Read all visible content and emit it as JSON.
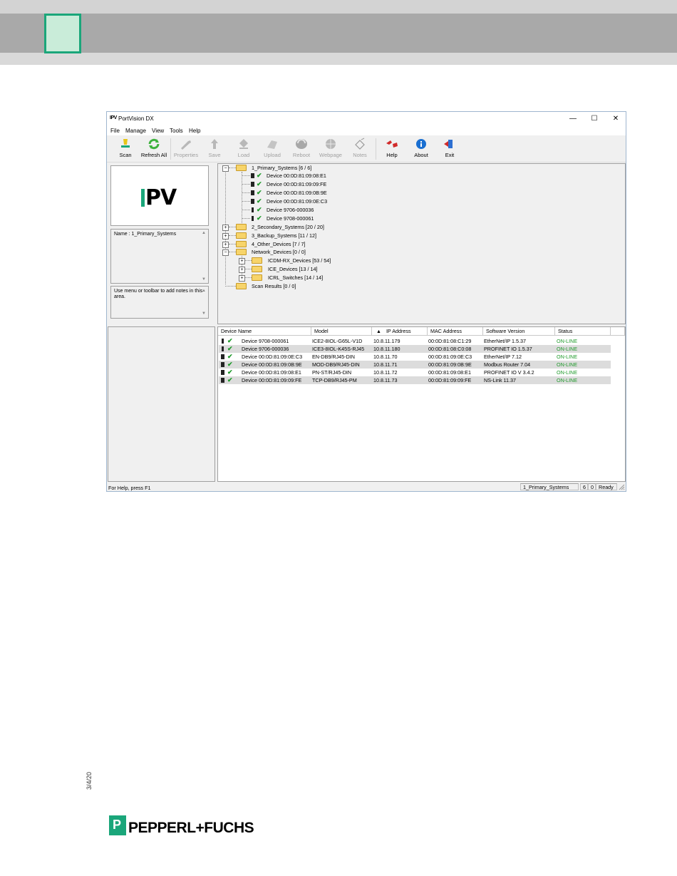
{
  "window": {
    "app_icon": "IPV",
    "title": "PortVision DX",
    "controls": [
      "—",
      "☐",
      "✕"
    ]
  },
  "menu": [
    "File",
    "Manage",
    "View",
    "Tools",
    "Help"
  ],
  "toolbar": {
    "scan": "Scan",
    "refresh_all": "Refresh All",
    "properties": "Properties",
    "save": "Save",
    "load": "Load",
    "upload": "Upload",
    "reboot": "Reboot",
    "webpage": "Webpage",
    "notes": "Notes",
    "help": "Help",
    "about": "About",
    "exit": "Exit"
  },
  "logo": {
    "text": "PV"
  },
  "name_box": "Name : 1_Primary_Systems",
  "notes_box": "Use menu or toolbar to add notes in this area.",
  "tree": {
    "primary": "1_Primary_Systems [6 / 6]",
    "primary_children": [
      "Device 00:0D:81:09:08:E1",
      "Device 00:0D:81:09:09:FE",
      "Device 00:0D:81:09:0B:9E",
      "Device 00:0D:81:09:0E:C3",
      "Device 9706-000036",
      "Device 9708-000061"
    ],
    "secondary": "2_Secondary_Systems [20 / 20]",
    "backup": "3_Backup_Systems [11 / 12]",
    "other": "4_Other_Devices [7 / 7]",
    "network": "Network_Devices [0 / 0]",
    "network_children": [
      "ICDM-RX_Devices [53 / 54]",
      "ICE_Devices [13 / 14]",
      "ICRL_Switches [14 / 14]"
    ],
    "scan_results": "Scan Results [0 / 0]"
  },
  "table": {
    "headers": [
      "Device Name",
      "Model",
      "IP Address",
      "MAC Address",
      "Software Version",
      "Status"
    ],
    "sort_arrow": "▲",
    "rows": [
      [
        "Device 9708-000061",
        "ICE2-8IOL-G65L-V1D",
        "10.8.11.179",
        "00:0D:81:08:C1:29",
        "EtherNet/IP 1.5.37",
        "ON-LINE"
      ],
      [
        "Device 9706-000036",
        "ICE3-8IOL-K45S-RJ45",
        "10.8.11.180",
        "00:0D:81:08:C0:08",
        "PROFINET IO 1.5.37",
        "ON-LINE"
      ],
      [
        "Device 00:0D:81:09:0E:C3",
        "EN-DB9/RJ45-DIN",
        "10.8.11.70",
        "00:0D:81:09:0E:C3",
        "EtherNet/IP 7.12",
        "ON-LINE"
      ],
      [
        "Device 00:0D:81:09:0B:9E",
        "MOD-DB9/RJ45-DIN",
        "10.8.11.71",
        "00:0D:81:09:0B:9E",
        "Modbus Router 7.04",
        "ON-LINE"
      ],
      [
        "Device 00:0D:81:09:08:E1",
        "PN-ST/RJ45-DIN",
        "10.8.11.72",
        "00:0D:81:09:08:E1",
        "PROFINET IO V 3.4.2",
        "ON-LINE"
      ],
      [
        "Device 00:0D:81:09:09:FE",
        "TCP-DB9/RJ45-PM",
        "10.8.11.73",
        "00:0D:81:09:09:FE",
        "NS-Link 11.37",
        "ON-LINE"
      ]
    ]
  },
  "status": {
    "help": "For Help, press F1",
    "group": "1_Primary_Systems",
    "count_a": "6",
    "count_b": "0",
    "state": "Ready"
  },
  "footer": {
    "date": "3/4/20",
    "brand_mark": "P",
    "brand": "PEPPERL+FUCHS"
  },
  "colors": {
    "accent": "#1aa67a",
    "online": "#1e9a2a",
    "header_band": "#a9a9a9"
  }
}
